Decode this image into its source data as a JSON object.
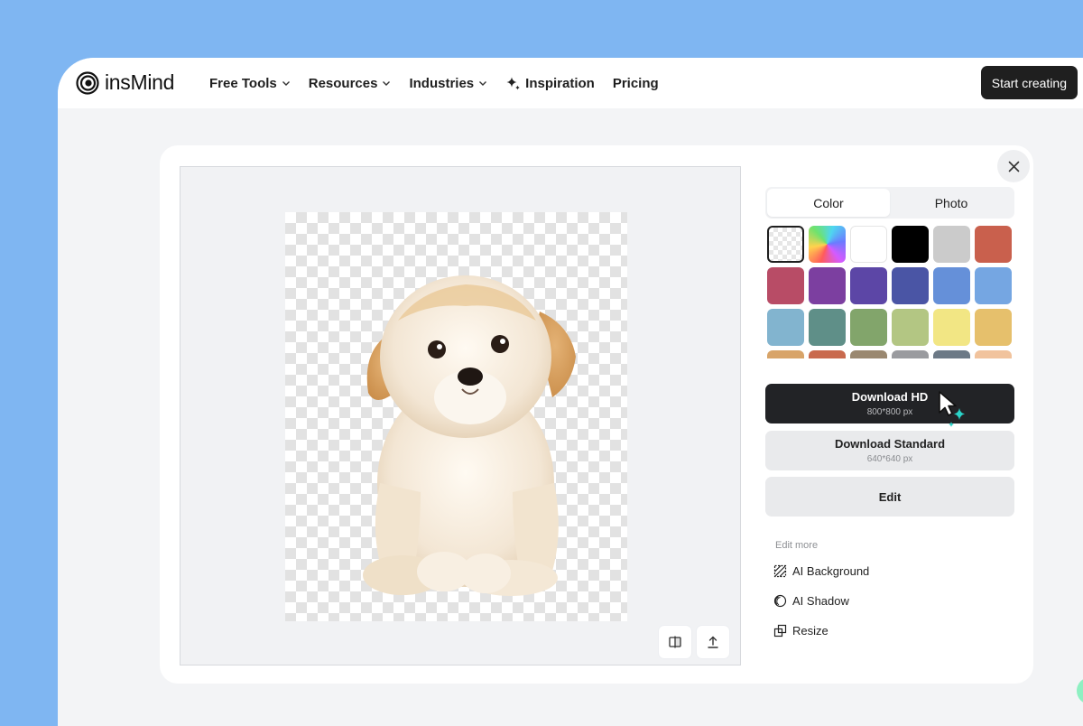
{
  "brand": {
    "name": "insMind"
  },
  "nav": {
    "items": [
      {
        "label": "Free Tools",
        "icon": "chevron-down-icon"
      },
      {
        "label": "Resources",
        "icon": "chevron-down-icon"
      },
      {
        "label": "Industries",
        "icon": "chevron-down-icon"
      },
      {
        "label": "Inspiration",
        "icon": "sparkle-icon"
      },
      {
        "label": "Pricing"
      }
    ],
    "cta": "Start creating"
  },
  "modal": {
    "tabs": [
      {
        "label": "Color",
        "active": true
      },
      {
        "label": "Photo",
        "active": false
      }
    ],
    "swatches": [
      "transparent",
      "rainbow",
      "#ffffff",
      "#000000",
      "#cbcbcb",
      "#c9604d",
      "#b84c66",
      "#7c3fa0",
      "#5c46a6",
      "#4a55a5",
      "#6590d9",
      "#75a6e2",
      "#82b4cf",
      "#5f8f88",
      "#82a56b",
      "#b3c683",
      "#f2e684",
      "#e6c06c",
      "#d8a469",
      "#c96a4e",
      "#9a8870",
      "#9a9b9f",
      "#6c7986",
      "#f1c39d"
    ],
    "selected_swatch": "transparent",
    "download_hd": {
      "label": "Download HD",
      "size": "800*800 px"
    },
    "download_standard": {
      "label": "Download Standard",
      "size": "640*640 px"
    },
    "edit_label": "Edit",
    "edit_more": {
      "heading": "Edit more",
      "items": [
        {
          "label": "AI Background",
          "icon": "ai-background-icon"
        },
        {
          "label": "AI Shadow",
          "icon": "ai-shadow-icon"
        },
        {
          "label": "Resize",
          "icon": "resize-icon"
        }
      ]
    },
    "canvas_tools": [
      {
        "icon": "compare-icon"
      },
      {
        "icon": "upload-icon"
      }
    ],
    "colors": {
      "primary_button": "#222326",
      "secondary_button": "#e9eaec",
      "cursor_accent": "#2ad3c8"
    }
  }
}
